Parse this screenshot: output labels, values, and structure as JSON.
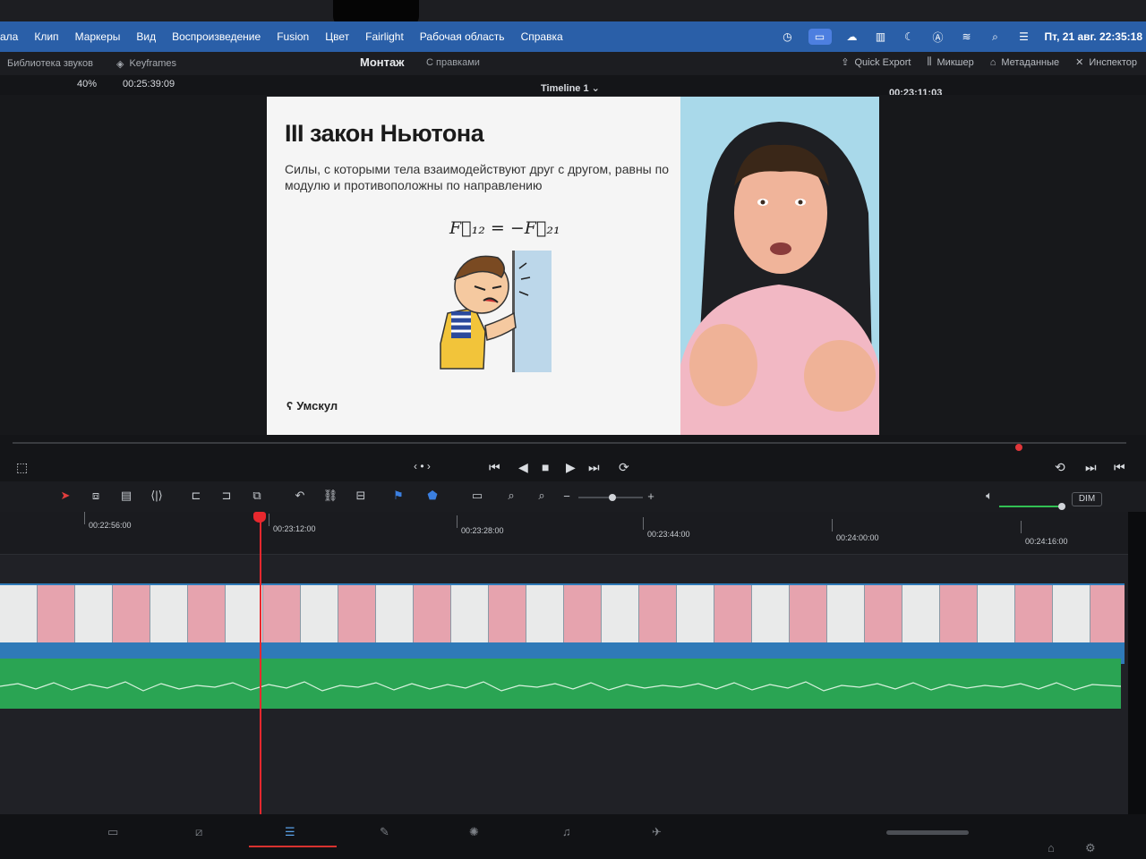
{
  "menubar": {
    "items": [
      "ала",
      "Клип",
      "Маркеры",
      "Вид",
      "Воспроизведение",
      "Fusion",
      "Цвет",
      "Fairlight",
      "Рабочая область",
      "Справка"
    ],
    "clock": "Пт, 21 авг. 22:35:18"
  },
  "header": {
    "sound_library": "Библиотека звуков",
    "keyframes": "Keyframes",
    "title": "Монтаж",
    "subtitle": "С правками",
    "quick_export": "Quick Export",
    "mixer": "Микшер",
    "metadata": "Метаданные",
    "inspector": "Инспектор"
  },
  "viewer": {
    "zoom": "40%",
    "source_timecode": "00:25:39:09",
    "timeline_name": "Timeline 1",
    "record_timecode": "00:23:11:03"
  },
  "slide": {
    "title": "III закон Ньютона",
    "description": "Силы, с которыми тела взаимодействуют друг с другом, равны по модулю и противоположны по направлению",
    "formula": "F⃗₁₂ = −F⃗₂₁",
    "brand": "Умскул"
  },
  "timeline": {
    "ruler": [
      "00:22:56:00",
      "00:23:12:00",
      "00:23:28:00",
      "00:23:44:00",
      "00:24:00:00",
      "00:24:16:00"
    ],
    "dim_label": "DIM"
  },
  "colors": {
    "menubar": "#2a5fa8",
    "video_track": "#2f7ab8",
    "audio_track": "#2aa453",
    "playhead": "#e8282e"
  }
}
